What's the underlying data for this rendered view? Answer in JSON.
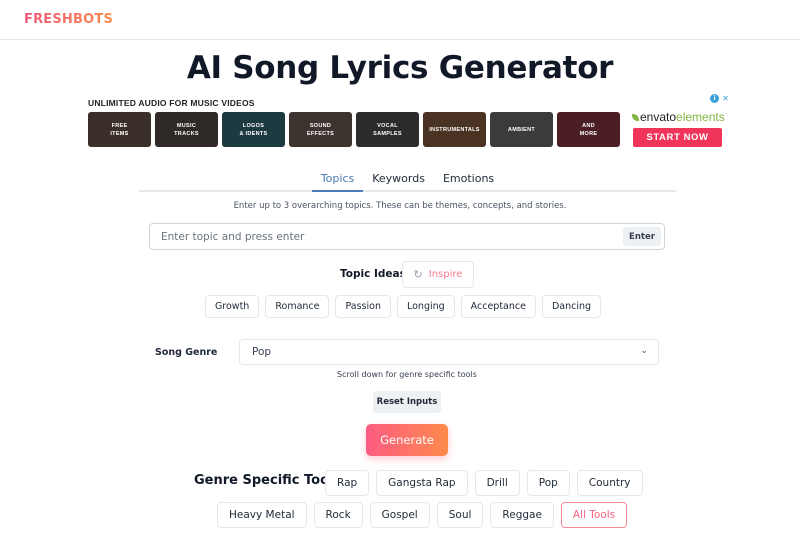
{
  "header": {
    "logo": "FRESHBOTS"
  },
  "page_title": "AI Song Lyrics Generator",
  "ad": {
    "title": "UNLIMITED AUDIO FOR MUSIC VIDEOS",
    "tiles": [
      {
        "label_line1": "FREE",
        "label_line2": "ITEMS",
        "color": "#3b2f2a"
      },
      {
        "label_line1": "MUSIC",
        "label_line2": "TRACKS",
        "color": "#2f2a27"
      },
      {
        "label_line1": "LOGOS",
        "label_line2": "& IDENTS",
        "color": "#1d3a40"
      },
      {
        "label_line1": "SOUND",
        "label_line2": "EFFECTS",
        "color": "#3d3430"
      },
      {
        "label_line1": "VOCAL",
        "label_line2": "SAMPLES",
        "color": "#2c2c2e"
      },
      {
        "label_line1": "INSTRUMENTALS",
        "label_line2": "",
        "color": "#4a3322"
      },
      {
        "label_line1": "AMBIENT",
        "label_line2": "",
        "color": "#3a3b3c"
      },
      {
        "label_line1": "AND",
        "label_line2": "MORE",
        "color": "#4a1e24"
      }
    ],
    "brand_envato": "envato",
    "brand_elements": "elements",
    "cta": "START NOW",
    "info_icon": "i",
    "close_icon": "✕"
  },
  "tabs": [
    {
      "label": "Topics",
      "active": true
    },
    {
      "label": "Keywords",
      "active": false
    },
    {
      "label": "Emotions",
      "active": false
    }
  ],
  "topics": {
    "hint": "Enter up to 3 overarching topics. These can be themes, concepts, and stories.",
    "input_value": "",
    "input_placeholder": "Enter topic and press enter",
    "enter_label": "Enter",
    "ideas_label": "Topic Ideas",
    "inspire_label": "Inspire",
    "ideas": [
      "Growth",
      "Romance",
      "Passion",
      "Longing",
      "Acceptance",
      "Dancing"
    ]
  },
  "genre": {
    "label": "Song Genre",
    "selected": "Pop",
    "hint": "Scroll down for genre specific tools"
  },
  "buttons": {
    "reset": "Reset Inputs",
    "generate": "Generate"
  },
  "genre_tools": {
    "label": "Genre Specific Tools",
    "row1": [
      "Rap",
      "Gangsta Rap",
      "Drill",
      "Pop",
      "Country"
    ],
    "row2": [
      "Heavy Metal",
      "Rock",
      "Gospel",
      "Soul",
      "Reggae"
    ],
    "all_tools": "All Tools"
  }
}
